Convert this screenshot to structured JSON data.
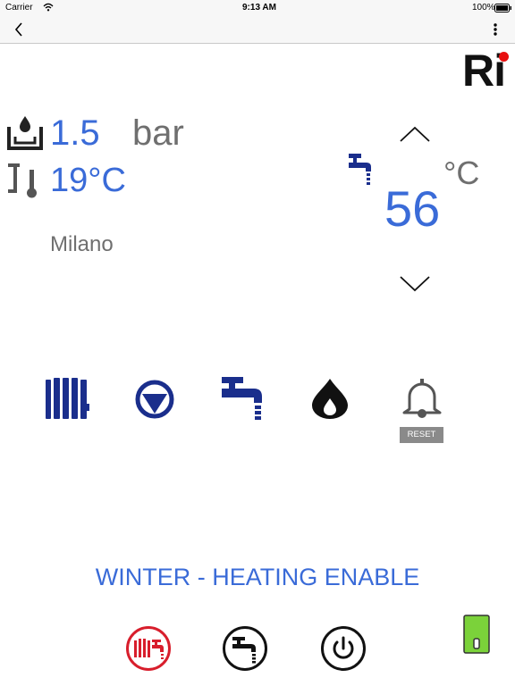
{
  "status_bar": {
    "carrier": "Carrier",
    "time": "9:13 AM",
    "battery": "100%"
  },
  "logo": {
    "text": "Ri"
  },
  "pressure": {
    "value": "1.5",
    "unit": "bar"
  },
  "outdoor": {
    "temperature": "19°C"
  },
  "location": {
    "city": "Milano"
  },
  "dhw_setpoint": {
    "unit": "°C",
    "value": "56"
  },
  "status_icons": {
    "reset_label": "RESET"
  },
  "mode": {
    "text": "WINTER - HEATING ENABLE"
  },
  "colors": {
    "accent_blue": "#3a6bd8",
    "icon_navy": "#1a2e8c",
    "heating_red": "#d81e2c",
    "green": "#7bd23a"
  }
}
